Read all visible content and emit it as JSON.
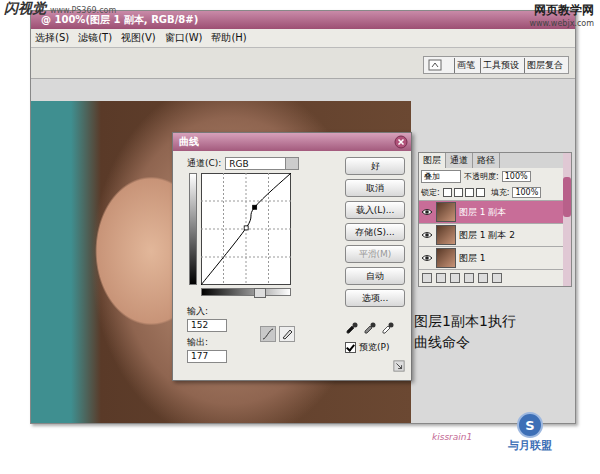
{
  "watermarks": {
    "left_logo": "闪视觉",
    "left_url": "www.PS369.com",
    "right_logo": "网页教学网",
    "right_url": "www.webjx.com",
    "signature": "kissrain1",
    "badge_letter": "S",
    "badge_text": "与月联盟"
  },
  "window": {
    "title": "@ 100%(图层 1 副本, RGB/8#)"
  },
  "menu": [
    "选择(S)",
    "滤镜(T)",
    "视图(V)",
    "窗口(W)",
    "帮助(H)"
  ],
  "palette_tabs": [
    {
      "label": "画笔",
      "selected": false
    },
    {
      "label": "工具预设",
      "selected": false
    },
    {
      "label": "图层复合",
      "selected": false
    }
  ],
  "curves_dialog": {
    "title": "曲线",
    "channel_label": "通道(C):",
    "channel": "RGB",
    "input_label": "输入:",
    "input": "152",
    "output_label": "输出:",
    "output": "177",
    "buttons": [
      {
        "label": "好",
        "disabled": false
      },
      {
        "label": "取消",
        "disabled": false
      },
      {
        "label": "载入(L)...",
        "disabled": false
      },
      {
        "label": "存储(S)...",
        "disabled": false
      },
      {
        "label": "平滑(M)",
        "disabled": true
      },
      {
        "label": "自动",
        "disabled": false
      },
      {
        "label": "选项...",
        "disabled": false
      }
    ],
    "preview": {
      "label": "预览(P)",
      "checked": true
    },
    "curve": {
      "points": [
        [
          0,
          0
        ],
        [
          128,
          130
        ],
        [
          152,
          177
        ],
        [
          255,
          255
        ]
      ],
      "selected_point": 2
    }
  },
  "layers_panel": {
    "tabs": [
      {
        "label": "图层",
        "selected": true
      },
      {
        "label": "通道",
        "selected": false
      },
      {
        "label": "路径",
        "selected": false
      }
    ],
    "blend_mode": "叠加",
    "opacity_label": "不透明度:",
    "opacity": "100%",
    "lock_label": "锁定:",
    "fill_label": "填充:",
    "fill": "100%",
    "layers": [
      {
        "name": "图层 1 副本",
        "selected": true,
        "visible": true
      },
      {
        "name": "图层 1 副本 2",
        "selected": false,
        "visible": true
      },
      {
        "name": "图层 1",
        "selected": false,
        "visible": true
      }
    ]
  },
  "caption": [
    "图层1副本1执行",
    "曲线命令"
  ]
}
